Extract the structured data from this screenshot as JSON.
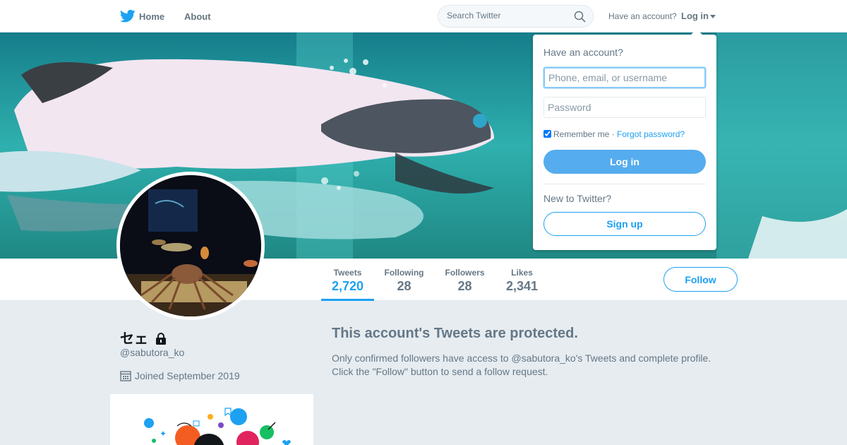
{
  "nav": {
    "home_label": "Home",
    "about_label": "About",
    "search_placeholder": "Search Twitter",
    "have_account": "Have an account?",
    "login_label": "Log in",
    "brand_color": "#1da1f2"
  },
  "login_dropdown": {
    "heading": "Have an account?",
    "username_placeholder": "Phone, email, or username",
    "password_placeholder": "Password",
    "remember_label": "Remember me",
    "separator": "·",
    "forgot_label": "Forgot password?",
    "remember_checked": true,
    "login_button": "Log in",
    "new_to_twitter": "New to Twitter?",
    "signup_button": "Sign up"
  },
  "profile": {
    "display_name": "セェ",
    "handle": "@sabutora_ko",
    "joined": "Joined September 2019",
    "protected": true
  },
  "stats": [
    {
      "label": "Tweets",
      "value": "2,720",
      "active": true
    },
    {
      "label": "Following",
      "value": "28",
      "active": false
    },
    {
      "label": "Followers",
      "value": "28",
      "active": false
    },
    {
      "label": "Likes",
      "value": "2,341",
      "active": false
    }
  ],
  "follow_button": "Follow",
  "protected_message": {
    "title": "This account's Tweets are protected.",
    "body_line1": "Only confirmed followers have access to @sabutora_ko's Tweets and complete profile.",
    "body_line2": "Click the \"Follow\" button to send a follow request."
  }
}
